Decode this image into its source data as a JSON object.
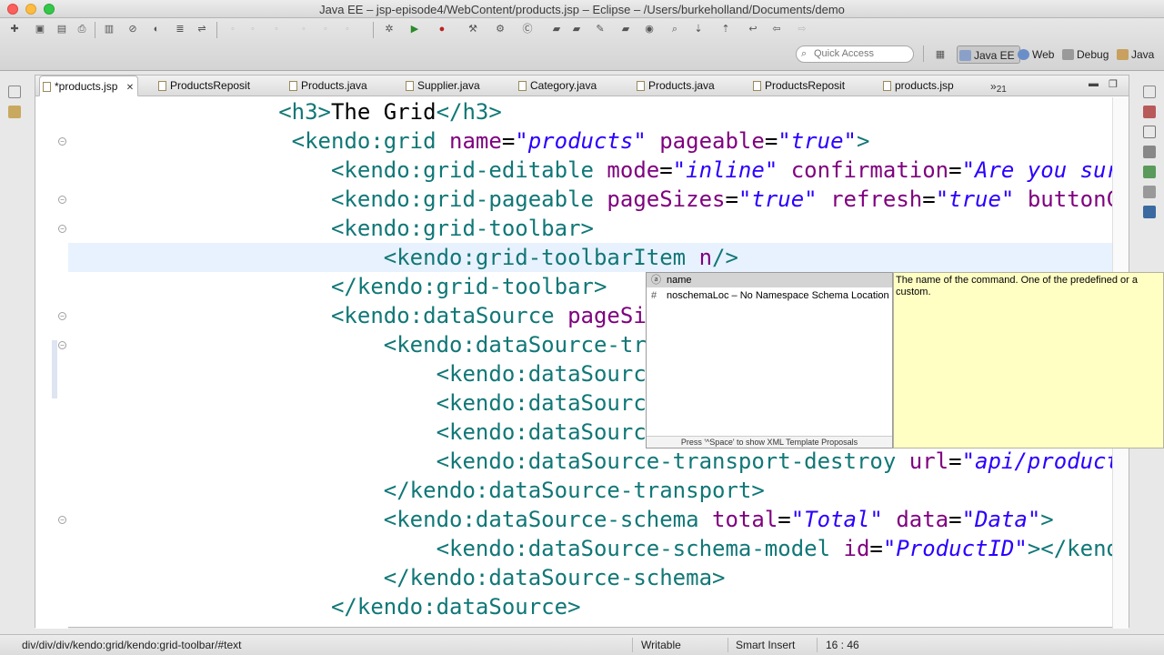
{
  "window": {
    "title": "Java EE – jsp-episode4/WebContent/products.jsp – Eclipse – /Users/burkeholland/Documents/demo"
  },
  "toolbar": {
    "quick_access_placeholder": "Quick Access",
    "perspectives": [
      {
        "label": "Java EE",
        "icon": "javaee-perspective-icon",
        "active": true
      },
      {
        "label": "Web",
        "icon": "web-perspective-icon",
        "active": false
      },
      {
        "label": "Debug",
        "icon": "debug-perspective-icon",
        "active": false
      },
      {
        "label": "Java",
        "icon": "java-perspective-icon",
        "active": false
      }
    ]
  },
  "tabs": [
    {
      "label": "*products.jsp",
      "active": true,
      "close": "✕"
    },
    {
      "label": "ProductsReposit"
    },
    {
      "label": "Products.java"
    },
    {
      "label": "Supplier.java"
    },
    {
      "label": "Category.java"
    },
    {
      "label": "Products.java"
    },
    {
      "label": "ProductsReposit"
    },
    {
      "label": "products.jsp"
    }
  ],
  "tab_overflow": {
    "chevron": "»",
    "count": "21"
  },
  "code": {
    "lines": [
      {
        "indent": "                ",
        "parts": [
          [
            "tag",
            "<h3>"
          ],
          [
            "txt",
            "The Grid"
          ],
          [
            "tag",
            "</h3>"
          ]
        ]
      },
      {
        "indent": "                 ",
        "parts": [
          [
            "tag",
            "<kendo:grid "
          ],
          [
            "attr",
            "name"
          ],
          [
            "txt",
            "="
          ],
          [
            "val",
            "\"products\""
          ],
          [
            "txt",
            " "
          ],
          [
            "attr",
            "pageable"
          ],
          [
            "txt",
            "="
          ],
          [
            "val",
            "\"true\""
          ],
          [
            "tag",
            ">"
          ]
        ]
      },
      {
        "indent": "                    ",
        "parts": [
          [
            "tag",
            "<kendo:grid-editable "
          ],
          [
            "attr",
            "mode"
          ],
          [
            "txt",
            "="
          ],
          [
            "val",
            "\"inline\""
          ],
          [
            "txt",
            " "
          ],
          [
            "attr",
            "confirmation"
          ],
          [
            "txt",
            "="
          ],
          [
            "val",
            "\"Are you sure yo"
          ]
        ]
      },
      {
        "indent": "                    ",
        "parts": [
          [
            "tag",
            "<kendo:grid-pageable "
          ],
          [
            "attr",
            "pageSizes"
          ],
          [
            "txt",
            "="
          ],
          [
            "val",
            "\"true\""
          ],
          [
            "txt",
            " "
          ],
          [
            "attr",
            "refresh"
          ],
          [
            "txt",
            "="
          ],
          [
            "val",
            "\"true\""
          ],
          [
            "txt",
            " "
          ],
          [
            "attr",
            "buttonCount"
          ]
        ]
      },
      {
        "indent": "                    ",
        "parts": [
          [
            "tag",
            "<kendo:grid-toolbar>"
          ]
        ]
      },
      {
        "indent": "                        ",
        "parts": [
          [
            "tag",
            "<kendo:grid-toolbarItem "
          ],
          [
            "attr",
            "n"
          ],
          [
            "tag",
            "/>"
          ]
        ],
        "current": true
      },
      {
        "indent": "                    ",
        "parts": [
          [
            "tag",
            "</kendo:grid-toolbar>"
          ]
        ]
      },
      {
        "indent": "                    ",
        "parts": [
          [
            "tag",
            "<kendo:dataSource "
          ],
          [
            "attr",
            "pageSize"
          ],
          [
            "txt",
            "="
          ],
          [
            "val",
            "\""
          ]
        ]
      },
      {
        "indent": "                        ",
        "parts": [
          [
            "tag",
            "<kendo:dataSource-transp"
          ]
        ]
      },
      {
        "indent": "                            ",
        "parts": [
          [
            "tag",
            "<kendo:dataSource-tr"
          ]
        ]
      },
      {
        "indent": "                            ",
        "parts": [
          [
            "tag",
            "<kendo:dataSource-tr"
          ]
        ]
      },
      {
        "indent": "                            ",
        "parts": [
          [
            "tag",
            "<kendo:dataSource-tr"
          ]
        ]
      },
      {
        "indent": "                            ",
        "parts": [
          [
            "tag",
            "<kendo:dataSource-transport-destroy "
          ],
          [
            "attr",
            "url"
          ],
          [
            "txt",
            "="
          ],
          [
            "val",
            "\"api/products?de"
          ]
        ]
      },
      {
        "indent": "                        ",
        "parts": [
          [
            "tag",
            "</kendo:dataSource-transport>"
          ]
        ]
      },
      {
        "indent": "                        ",
        "parts": [
          [
            "tag",
            "<kendo:dataSource-schema "
          ],
          [
            "attr",
            "total"
          ],
          [
            "txt",
            "="
          ],
          [
            "val",
            "\"Total\""
          ],
          [
            "txt",
            " "
          ],
          [
            "attr",
            "data"
          ],
          [
            "txt",
            "="
          ],
          [
            "val",
            "\"Data\""
          ],
          [
            "tag",
            ">"
          ]
        ]
      },
      {
        "indent": "                            ",
        "parts": [
          [
            "tag",
            "<kendo:dataSource-schema-model "
          ],
          [
            "attr",
            "id"
          ],
          [
            "txt",
            "="
          ],
          [
            "val",
            "\"ProductID\""
          ],
          [
            "tag",
            "></kendo:da"
          ]
        ]
      },
      {
        "indent": "                        ",
        "parts": [
          [
            "tag",
            "</kendo:dataSource-schema>"
          ]
        ]
      },
      {
        "indent": "                    ",
        "parts": [
          [
            "tag",
            "</kendo:dataSource>"
          ]
        ]
      }
    ]
  },
  "autocomplete": {
    "items": [
      {
        "label": "name",
        "icon": "attribute-icon",
        "symbol": "ⓐ",
        "selected": true
      },
      {
        "label": "noschemaLoc – No Namespace Schema Location",
        "icon": "hash-icon",
        "symbol": "#",
        "selected": false
      }
    ],
    "footer": "Press '^Space' to show XML Template Proposals",
    "doc": "The name of the command. One of the predefined or a custom."
  },
  "statusbar": {
    "breadcrumb": "div/div/div/kendo:grid/kendo:grid-toolbar/#text",
    "mode": "Writable",
    "insert": "Smart Insert",
    "position": "16 : 46"
  }
}
